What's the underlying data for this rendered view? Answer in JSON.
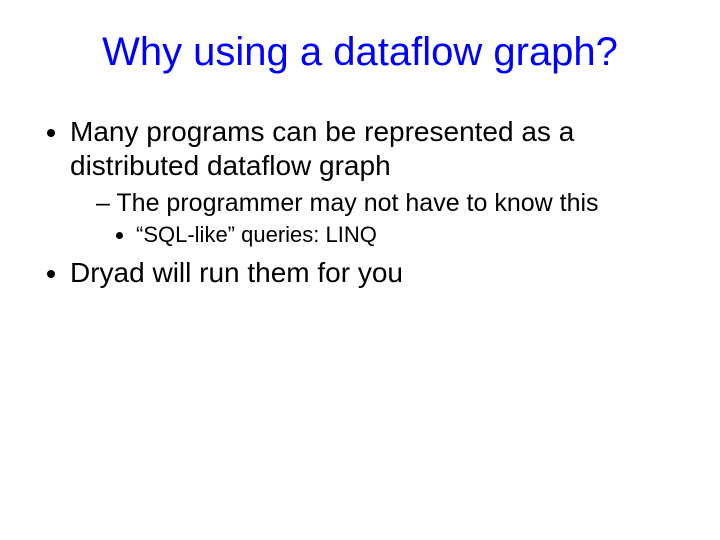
{
  "title": "Why using a dataflow graph?",
  "bullets": {
    "b1": "Many programs can be represented as a distributed dataflow graph",
    "b1_1": "The programmer may not have to know this",
    "b1_1_1": "“SQL-like” queries: LINQ",
    "b2": "Dryad will run them for you"
  }
}
